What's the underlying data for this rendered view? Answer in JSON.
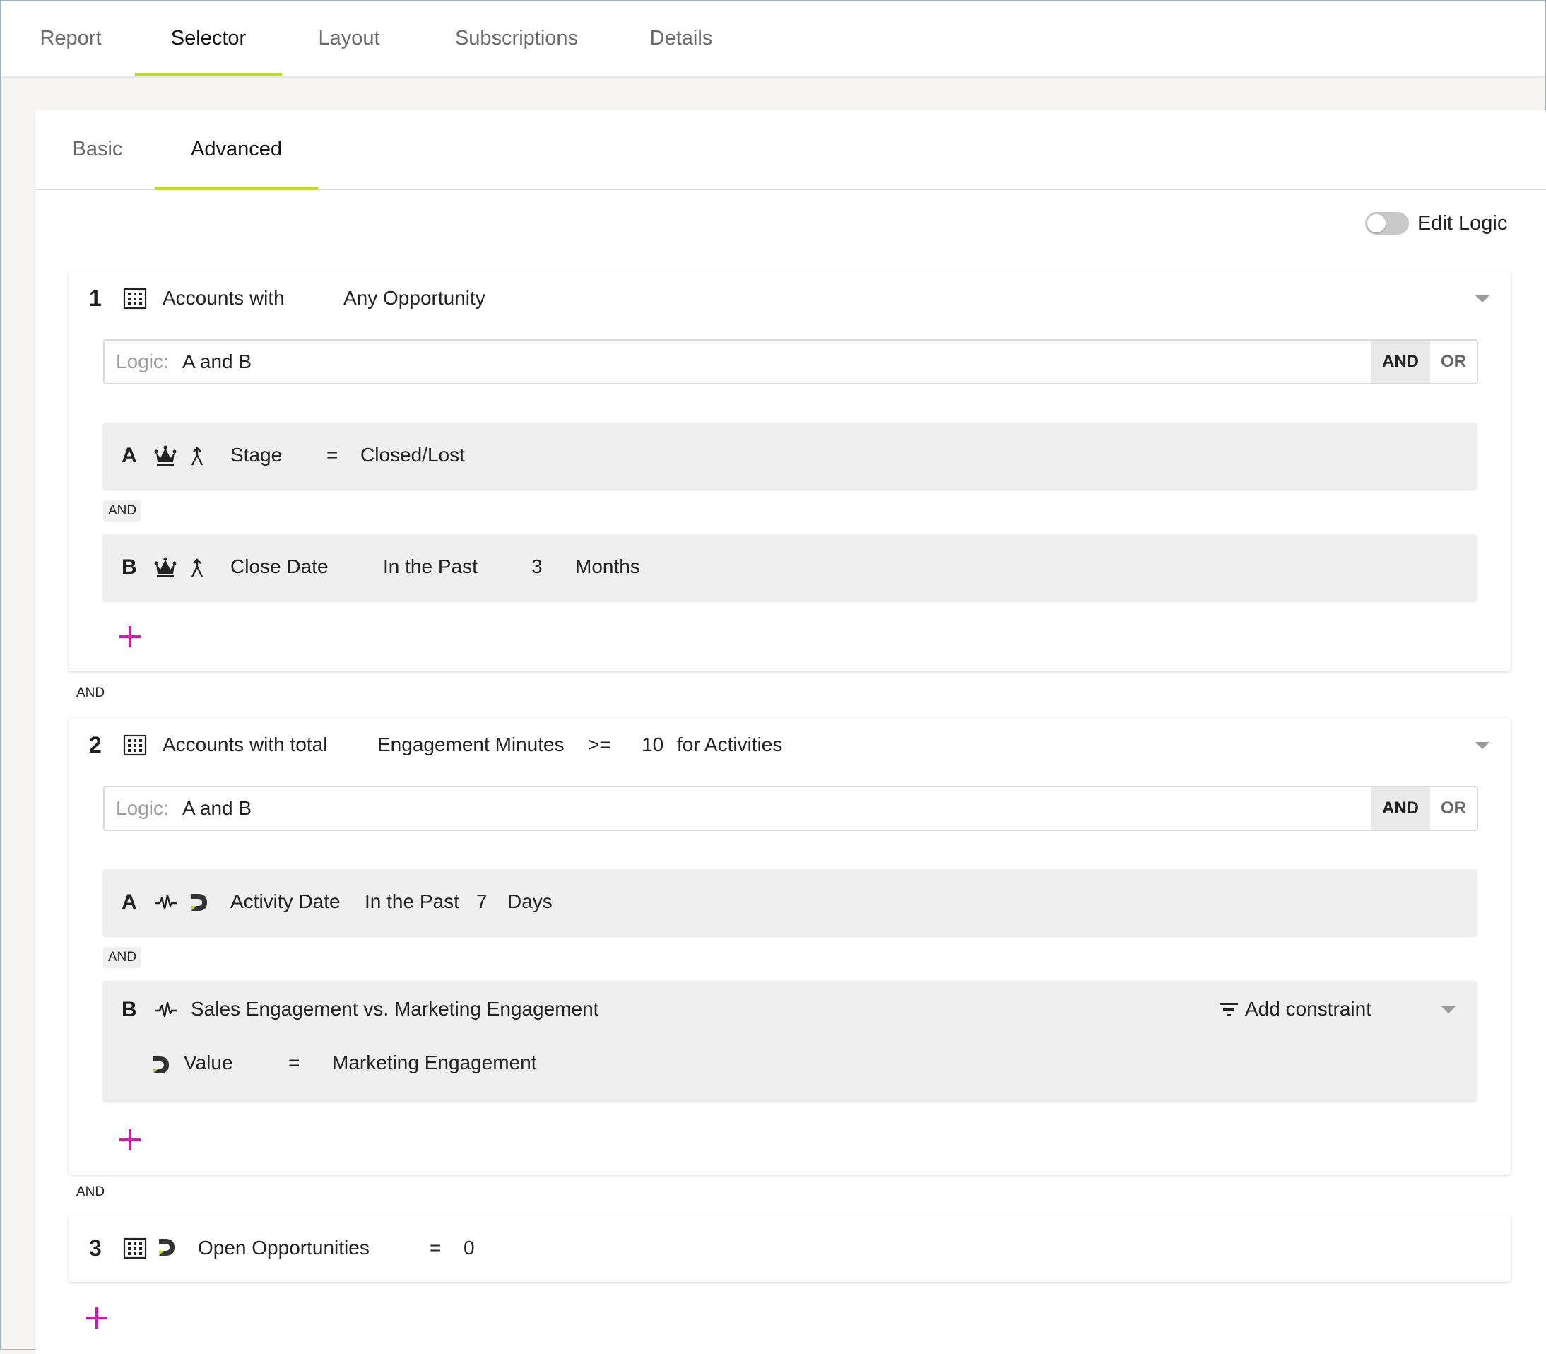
{
  "top_tabs": [
    "Report",
    "Selector",
    "Layout",
    "Subscriptions",
    "Details"
  ],
  "sub_tabs": [
    "Basic",
    "Advanced"
  ],
  "edit_logic_label": "Edit Logic",
  "groups": [
    {
      "num": "1",
      "title": "Accounts with",
      "object": "Any Opportunity",
      "logic_label": "Logic:",
      "logic_value": "A and B",
      "and_btn": "AND",
      "or_btn": "OR",
      "conditions": [
        {
          "letter": "A",
          "field": "Stage",
          "op": "=",
          "value": "Closed/Lost"
        },
        {
          "letter": "B",
          "field": "Close Date",
          "op": "In the Past",
          "value": "3",
          "unit": "Months"
        }
      ],
      "between": "AND"
    },
    {
      "num": "2",
      "title": "Accounts with total",
      "metric": "Engagement Minutes",
      "op": ">=",
      "value": "10",
      "suffix": "for Activities",
      "logic_label": "Logic:",
      "logic_value": "A and B",
      "and_btn": "AND",
      "or_btn": "OR",
      "conditions": [
        {
          "letter": "A",
          "field": "Activity Date",
          "op": "In the Past",
          "value": "7",
          "unit": "Days"
        },
        {
          "letter": "B",
          "field": "Sales Engagement vs. Marketing Engagement",
          "add_constraint": "Add constraint",
          "sub_field": "Value",
          "sub_op": "=",
          "sub_value": "Marketing Engagement"
        }
      ],
      "between": "AND"
    },
    {
      "num": "3",
      "field": "Open Opportunities",
      "op": "=",
      "value": "0"
    }
  ],
  "group_joiners": [
    "AND",
    "AND"
  ],
  "colors": {
    "accent": "#bcd53a",
    "plus": "#d01aa6"
  }
}
